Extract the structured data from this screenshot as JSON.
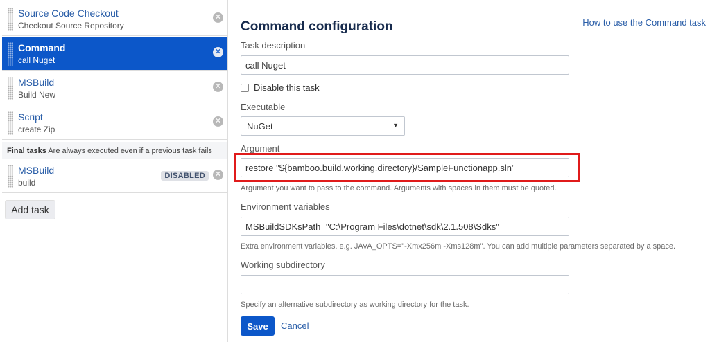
{
  "sidebar": {
    "tasks": [
      {
        "title": "Source Code Checkout",
        "subtitle": "Checkout Source Repository"
      },
      {
        "title": "Command",
        "subtitle": "call Nuget"
      },
      {
        "title": "MSBuild",
        "subtitle": "Build New"
      },
      {
        "title": "Script",
        "subtitle": "create Zip"
      }
    ],
    "final_tasks": {
      "heading": "Final tasks",
      "note": "Are always executed even if a previous task fails",
      "tasks": [
        {
          "title": "MSBuild",
          "subtitle": "build",
          "badge": "DISABLED"
        }
      ]
    },
    "remove_glyph": "✕",
    "add_task_label": "Add task"
  },
  "main": {
    "help_link": "How to use the Command task",
    "heading": "Command configuration",
    "task_description": {
      "label": "Task description",
      "value": "call Nuget"
    },
    "disable_label": "Disable this task",
    "executable": {
      "label": "Executable",
      "value": "NuGet"
    },
    "argument": {
      "label": "Argument",
      "value": "restore \"${bamboo.build.working.directory}/SampleFunctionapp.sln\"",
      "help": "Argument you want to pass to the command. Arguments with spaces in them must be quoted."
    },
    "env_vars": {
      "label": "Environment variables",
      "value": "MSBuildSDKsPath=\"C:\\Program Files\\dotnet\\sdk\\2.1.508\\Sdks\"",
      "help": "Extra environment variables. e.g. JAVA_OPTS=\"-Xmx256m -Xms128m\". You can add multiple parameters separated by a space."
    },
    "working_dir": {
      "label": "Working subdirectory",
      "value": "",
      "help": "Specify an alternative subdirectory as working directory for the task."
    },
    "save_label": "Save",
    "cancel_label": "Cancel"
  },
  "colors": {
    "accent": "#0c57c9",
    "highlight": "#e01b1b",
    "link": "#2a5ea8"
  }
}
